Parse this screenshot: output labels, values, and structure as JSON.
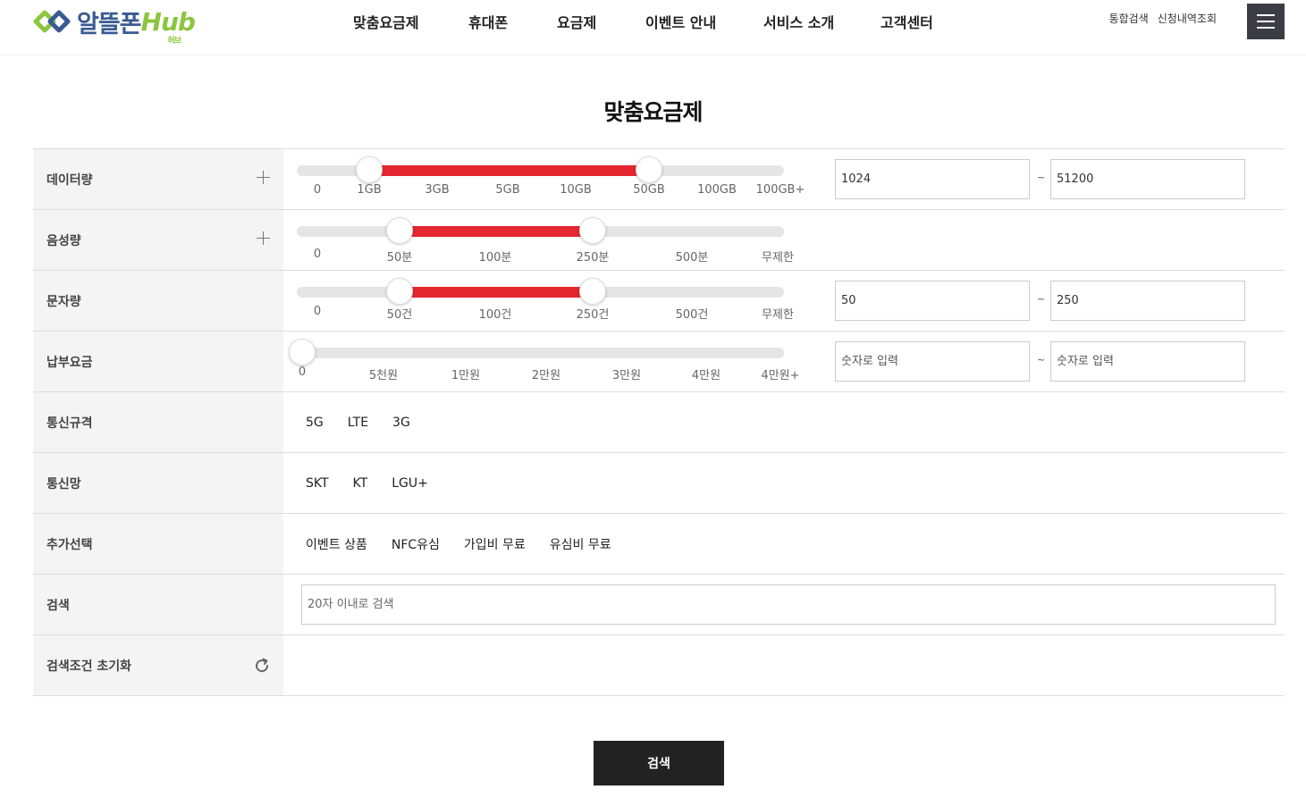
{
  "logo": {
    "text": "알뜰폰",
    "hub": "Hub",
    "hub_sub": "허브"
  },
  "nav": [
    "맞춤요금제",
    "휴대폰",
    "요금제",
    "이벤트 안내",
    "서비스 소개",
    "고객센터"
  ],
  "util": [
    "통합검색",
    "신청내역조회"
  ],
  "page_title": "맞춤요금제",
  "filters": {
    "data": {
      "label": "데이터량",
      "ticks": [
        "0",
        "1GB",
        "3GB",
        "5GB",
        "10GB",
        "50GB",
        "100GB",
        "100GB+"
      ],
      "range_ticks": [
        "1GB",
        "50GB"
      ],
      "min_value": "1024",
      "max_value": "51200"
    },
    "voice": {
      "label": "음성량",
      "ticks": [
        "0",
        "50분",
        "100분",
        "250분",
        "500분",
        "무제한"
      ],
      "range_ticks": [
        "50분",
        "250분"
      ]
    },
    "sms": {
      "label": "문자량",
      "ticks": [
        "0",
        "50건",
        "100건",
        "250건",
        "500건",
        "무제한"
      ],
      "range_ticks": [
        "50건",
        "250건"
      ],
      "min_value": "50",
      "max_value": "250"
    },
    "fee": {
      "label": "납부요금",
      "ticks": [
        "0",
        "5천원",
        "1만원",
        "2만원",
        "3만원",
        "4만원",
        "4만원+"
      ],
      "range_ticks": [
        "0",
        "0"
      ],
      "min_placeholder": "숫자로 입력",
      "max_placeholder": "숫자로 입력"
    },
    "network_type": {
      "label": "통신규격",
      "options": [
        "5G",
        "LTE",
        "3G"
      ]
    },
    "carrier": {
      "label": "통신망",
      "options": [
        "SKT",
        "KT",
        "LGU+"
      ]
    },
    "extra": {
      "label": "추가선택",
      "options": [
        "이벤트 상품",
        "NFC유심",
        "가입비 무료",
        "유심비 무료"
      ]
    },
    "search": {
      "label": "검색",
      "placeholder": "20자 이내로 검색"
    },
    "reset": {
      "label": "검색조건 초기화"
    }
  },
  "tilde": "~",
  "submit_label": "검색",
  "colors": {
    "accent": "#e32630",
    "brand_blue": "#3a5a92",
    "brand_green": "#8cc63f",
    "dark": "#222222"
  },
  "icons": {
    "menu": "hamburger-icon",
    "plus": "plus-icon",
    "reset": "refresh-icon",
    "logo": "logo-mark-icon"
  }
}
